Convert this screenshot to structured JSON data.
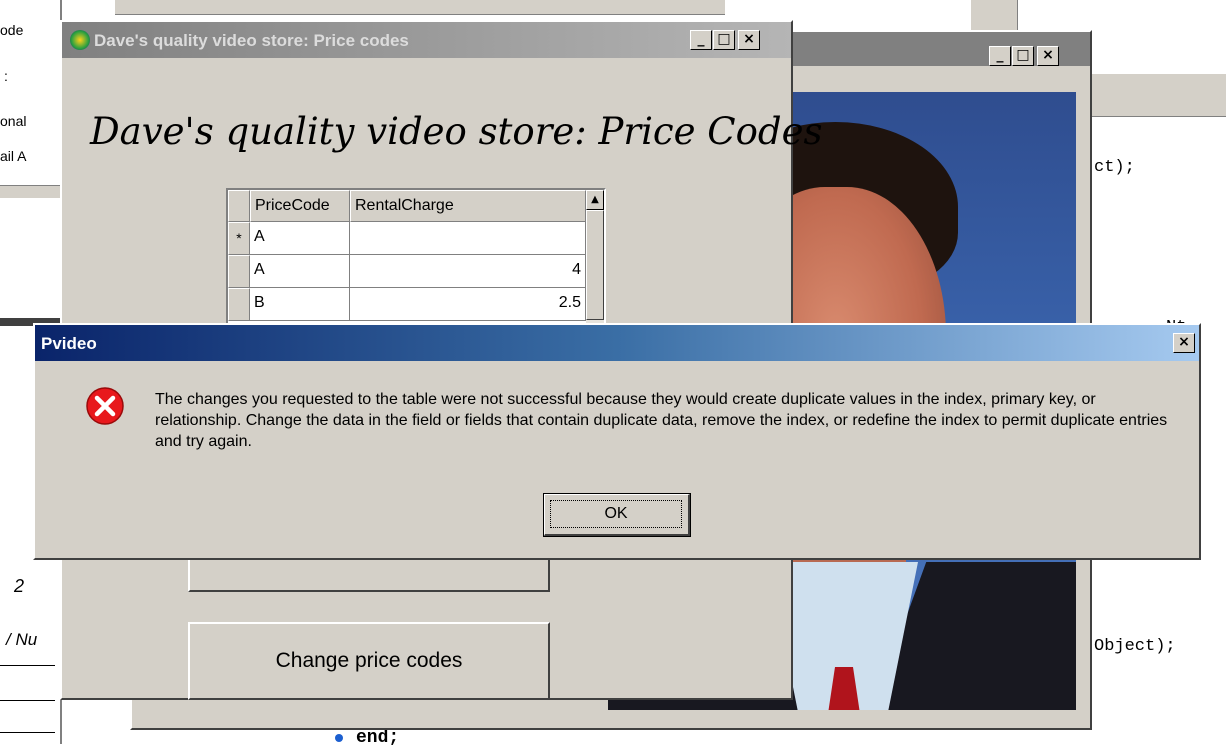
{
  "background_code": {
    "tokens_left": [
      "ode",
      ":",
      "onal",
      "ail A",
      "2",
      "/ Nu"
    ],
    "line_ct": "ct);",
    "line_nt": "Nt",
    "line_object": "Object);",
    "line_end": "end;"
  },
  "photo_window": {
    "buttons": [
      "_",
      "□",
      "×"
    ]
  },
  "main_window": {
    "title": "Dave's quality video store: Price codes",
    "heading": "Dave's quality video store: Price Codes",
    "buttons": [
      "_",
      "□",
      "×"
    ],
    "grid": {
      "columns": [
        "PriceCode",
        "RentalCharge"
      ],
      "rows": [
        {
          "indicator": "*",
          "code": "A",
          "charge": ""
        },
        {
          "indicator": "",
          "code": "A",
          "charge": "4"
        },
        {
          "indicator": "",
          "code": "B",
          "charge": "2.5"
        }
      ]
    },
    "change_button": "Change price codes"
  },
  "dialog": {
    "title": "Pvideo",
    "close": "×",
    "message": "The changes you requested to the table were not successful because they would create duplicate values in the index, primary key, or relationship.  Change the data in the field or fields that contain duplicate data, remove the index, or redefine the index to permit duplicate entries and try again.",
    "ok_label": "OK",
    "icon": "error-icon"
  },
  "colors": {
    "face": "#d4d0c8",
    "dialog_title_start": "#0a246a",
    "dialog_title_end": "#a6caf0",
    "error_red": "#e8181c"
  }
}
